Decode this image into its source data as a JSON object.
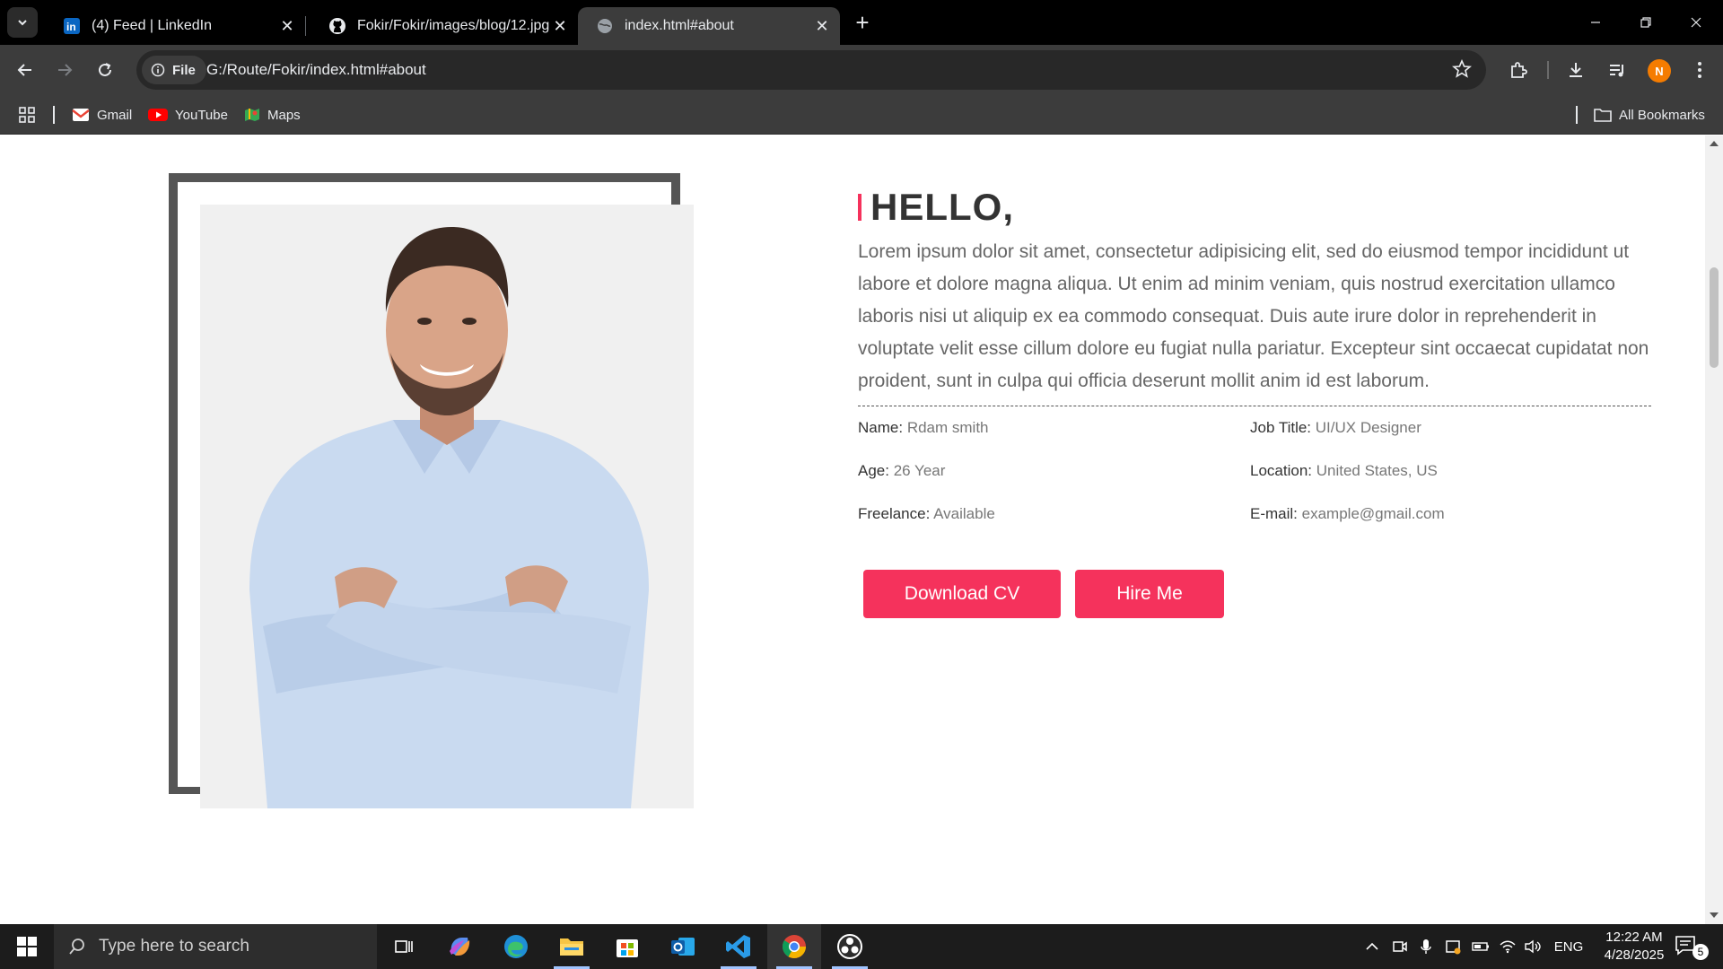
{
  "browser": {
    "tabs": [
      {
        "title": "(4) Feed | LinkedIn",
        "icon": "linkedin-icon"
      },
      {
        "title": "Fokir/Fokir/images/blog/12.jpg",
        "icon": "github-icon"
      },
      {
        "title": "index.html#about",
        "icon": "globe-icon"
      }
    ],
    "url_chip": "File",
    "url": "G:/Route/Fokir/index.html#about",
    "avatar_initial": "N",
    "bookmarks": [
      {
        "label": "Gmail",
        "icon": "gmail-icon"
      },
      {
        "label": "YouTube",
        "icon": "youtube-icon"
      },
      {
        "label": "Maps",
        "icon": "maps-icon"
      }
    ],
    "all_bookmarks": "All Bookmarks"
  },
  "about": {
    "heading": "HELLO,",
    "text": "Lorem ipsum dolor sit amet, consectetur adipisicing elit, sed do eiusmod tempor incididunt ut labore et dolore magna aliqua. Ut enim ad minim veniam, quis nostrud exercitation ullamco laboris nisi ut aliquip ex ea commodo consequat. Duis aute irure dolor in reprehenderit in voluptate velit esse cillum dolore eu fugiat nulla pariatur. Excepteur sint occaecat cupidatat non proident, sunt in culpa qui officia deserunt mollit anim id est laborum.",
    "info": [
      {
        "label": "Name:",
        "value": "Rdam smith"
      },
      {
        "label": "Job Title:",
        "value": "UI/UX Designer"
      },
      {
        "label": "Age:",
        "value": "26 Year"
      },
      {
        "label": "Location:",
        "value": "United States, US"
      },
      {
        "label": "Freelance:",
        "value": "Available"
      },
      {
        "label": "E-mail:",
        "value": "example@gmail.com"
      }
    ],
    "buttons": {
      "download": "Download CV",
      "hire": "Hire Me"
    }
  },
  "taskbar": {
    "search_placeholder": "Type here to search",
    "language": "ENG",
    "time": "12:22 AM",
    "date": "4/28/2025",
    "notification_count": "5"
  },
  "colors": {
    "accent": "#f5325c",
    "frame": "#555555"
  }
}
